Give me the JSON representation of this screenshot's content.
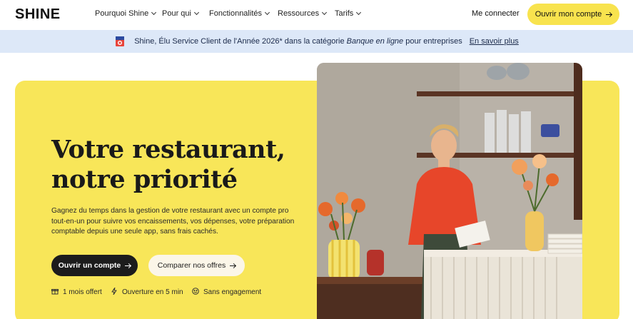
{
  "header": {
    "logo": "SHINE",
    "nav": [
      {
        "label": "Pourquoi Shine"
      },
      {
        "label": "Pour qui"
      },
      {
        "label": "Fonctionnalités"
      },
      {
        "label": "Ressources"
      },
      {
        "label": "Tarifs"
      }
    ],
    "login": "Me connecter",
    "cta": "Ouvrir mon compte"
  },
  "banner": {
    "text_before": "Shine, Élu Service Client de l'Année 2026* dans la catégorie ",
    "text_italic": "Banque en ligne",
    "text_after": " pour entreprises",
    "link": "En savoir plus"
  },
  "hero": {
    "title_line1": "Votre restaurant,",
    "title_line2": "notre priorité",
    "description": "Gagnez du temps dans la gestion de votre restaurant avec un compte pro tout-en-un pour suivre vos encaissements, vos dépenses, votre préparation comptable depuis une seule app, sans frais cachés.",
    "primary_cta": "Ouvrir un compte",
    "secondary_cta": "Comparer nos offres",
    "features": [
      {
        "icon": "gift-icon",
        "label": "1 mois offert"
      },
      {
        "icon": "lightning-icon",
        "label": "Ouverture en 5 min"
      },
      {
        "icon": "smiley-icon",
        "label": "Sans engagement"
      }
    ]
  },
  "colors": {
    "brand_yellow": "#f8e659",
    "banner_blue": "#dde8f8",
    "dark": "#1c1c1c"
  }
}
